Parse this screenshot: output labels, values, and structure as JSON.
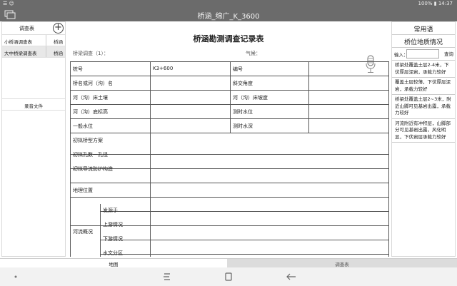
{
  "status_bar": {
    "time_left": "☰ ☺",
    "right": "100% ▮ 14:37"
  },
  "window": {
    "title": "桥涵_绵广_K_3600"
  },
  "left_panel": {
    "header": "调查表",
    "add_label": "+",
    "rows": [
      {
        "name": "小桥涵调查表",
        "tag": "桥涵"
      },
      {
        "name": "大中桥梁调查表",
        "tag": "桥涵"
      }
    ],
    "section": "录音文件"
  },
  "form": {
    "title": "桥涵勘测调查记录表",
    "survey_label": "桥梁调查（1）：",
    "weather_label": "气候：",
    "rows": [
      {
        "c1": "桩号",
        "c2": "K3+600",
        "c3": "编号",
        "c4": ""
      },
      {
        "c1": "桥名或河（沟）名",
        "c2": "",
        "c3": "斜交角度",
        "c4": ""
      },
      {
        "c1": "河（沟）床土壤",
        "c2": "",
        "c3": "河（沟）床坡度",
        "c4": ""
      },
      {
        "c1": "河（沟）底标高",
        "c2": "",
        "c3": "测时水位",
        "c4": ""
      },
      {
        "c1": "一般水位",
        "c2": "",
        "c3": "测时水深",
        "c4": ""
      }
    ],
    "full_rows": [
      "初拟桥型方案",
      "初拟孔数一孔径",
      "初拟导流防护构造",
      "地理位置"
    ],
    "flow_group": {
      "label": "河流概况",
      "items": [
        "发源于",
        "上游情况",
        "下游情况",
        "水文分区"
      ]
    }
  },
  "right_panel": {
    "tab_phrases": "常用语",
    "tab_geology": "桥位地质情况",
    "search_label": "输入：",
    "search_button": "查询",
    "items": [
      "桥梁处覆盖土层2-4米，下伏厚层泥岩，承载力较好",
      "覆盖土层较薄，下伏厚层泥岩，承载力较好",
      "桥梁处覆盖土层2~3米，附近山脚可见基岩出露，承载力较好",
      "河流附近有冲积层，山脚部分可见基岩出露，风化明显，下伏岩层承载力较好"
    ]
  },
  "bottom_tabs": [
    "地图",
    "调查表"
  ],
  "nav": [
    "recent-apps",
    "home",
    "back"
  ]
}
